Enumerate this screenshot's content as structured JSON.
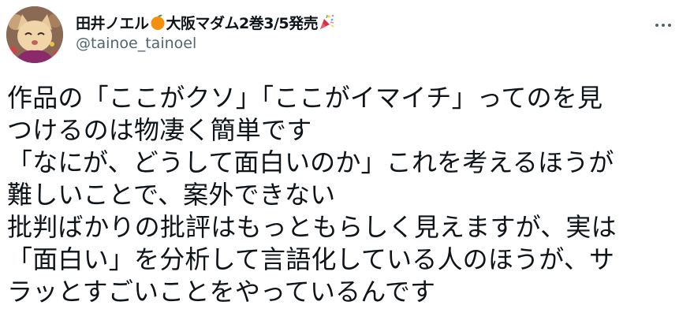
{
  "tweet": {
    "author": {
      "name_part1": "田井ノエル",
      "name_part2": "大阪マダム2巻3/5発売",
      "handle": "@tainoe_tainoel",
      "name_emojis": [
        "tangerine-emoji",
        "party-popper-emoji"
      ]
    },
    "more_icon": "more-horizontal-icon",
    "text_lines": [
      "作品の「ここがクソ」「ここがイマイチ」ってのを見",
      "つけるのは物凄く簡単です",
      "「なにが、どうして面白いのか」これを考えるほうが",
      "難しいことで、案外できない",
      "批判ばかりの批評はもっともらしく見えますが、実は",
      "「面白い」を分析して言語化している人のほうが、サ",
      "ラッとすごいことをやっているんです"
    ]
  },
  "colors": {
    "text": "#0f1419",
    "secondary": "#536471",
    "tangerine": "#f4900c"
  }
}
